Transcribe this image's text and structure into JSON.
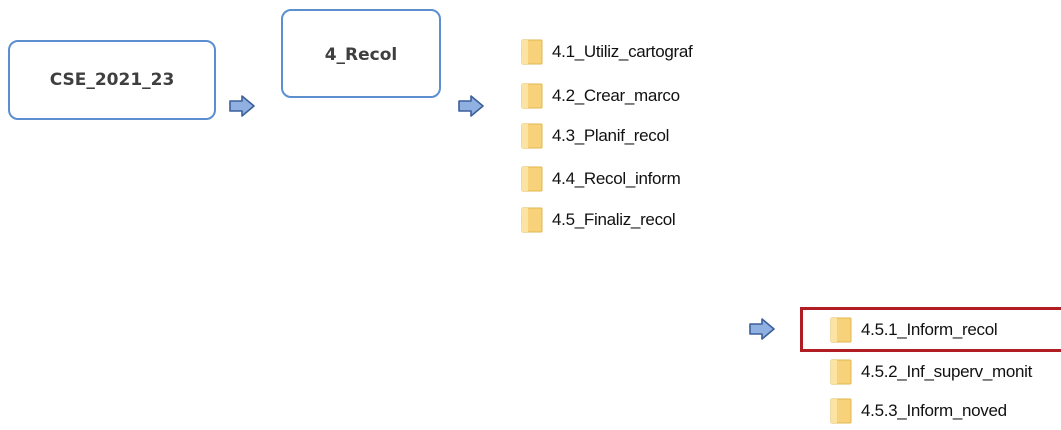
{
  "boxes": {
    "root": "CSE_2021_23",
    "recol": "4_Recol"
  },
  "folders_level1": [
    "4.1_Utiliz_cartograf",
    "4.2_Crear_marco",
    "4.3_Planif_recol",
    "4.4_Recol_inform",
    "4.5_Finaliz_recol"
  ],
  "folders_level2": [
    "4.5.1_Inform_recol",
    "4.5.2_Inf_superv_monit",
    "4.5.3_Inform_noved"
  ],
  "icons": {
    "arrow": "right-arrow-icon",
    "folder": "folder-icon"
  },
  "colors": {
    "box_border": "#5b8fd0",
    "arrow_fill": "#8fb0e0",
    "arrow_stroke": "#3d5f9a",
    "folder_fill": "#f7d27a",
    "highlight": "#b01e23"
  }
}
